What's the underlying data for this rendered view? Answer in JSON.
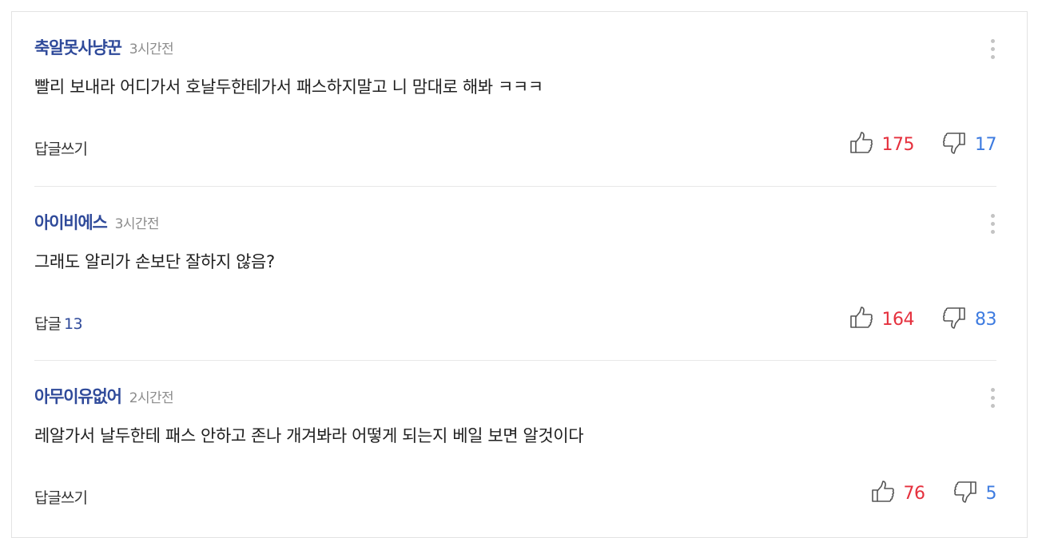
{
  "comments": [
    {
      "author": "축알못사냥꾼",
      "time": "3시간전",
      "text": "빨리 보내라 어디가서 호날두한테가서 패스하지말고 니 맘대로 해봐 ㅋㅋㅋ",
      "reply_label": "답글쓰기",
      "reply_count": "",
      "likes": "175",
      "dislikes": "17"
    },
    {
      "author": "아이비에스",
      "time": "3시간전",
      "text": "그래도 알리가 손보단 잘하지 않음?",
      "reply_label": "답글",
      "reply_count": "13",
      "likes": "164",
      "dislikes": "83"
    },
    {
      "author": "아무이유없어",
      "time": "2시간전",
      "text": "레알가서 날두한테 패스 안하고 존나 개겨봐라 어떻게 되는지 베일 보면 알것이다",
      "reply_label": "답글쓰기",
      "reply_count": "",
      "likes": "76",
      "dislikes": "5"
    }
  ],
  "icons": {
    "like": "thumbs-up-icon",
    "dislike": "thumbs-down-icon",
    "more": "more-vertical-icon"
  },
  "colors": {
    "author": "#2f4a9a",
    "likes": "#e5303d",
    "dislikes": "#3d7be0",
    "time": "#8c8c8c"
  }
}
